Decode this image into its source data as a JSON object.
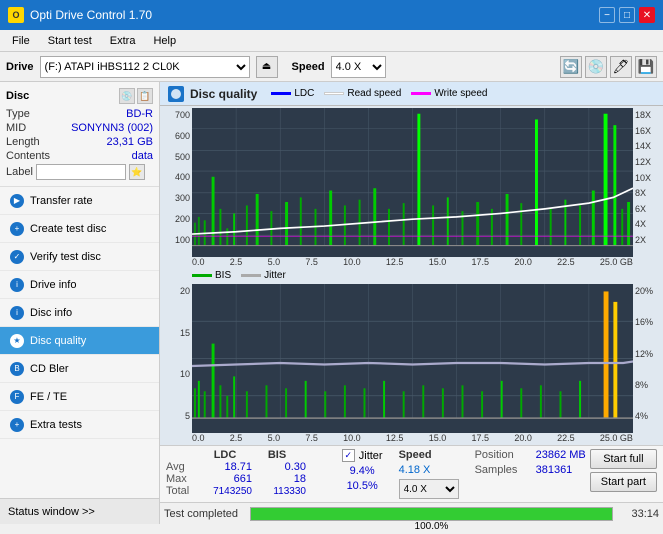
{
  "titlebar": {
    "title": "Opti Drive Control 1.70",
    "icon": "O",
    "minimize": "−",
    "maximize": "□",
    "close": "✕"
  },
  "menubar": {
    "items": [
      "File",
      "Start test",
      "Extra",
      "Help"
    ]
  },
  "drivebar": {
    "label": "Drive",
    "drive_value": "(F:)  ATAPI iHBS112  2 CL0K",
    "speed_label": "Speed",
    "speed_value": "4.0 X"
  },
  "disc": {
    "title": "Disc",
    "type_label": "Type",
    "type_val": "BD-R",
    "mid_label": "MID",
    "mid_val": "SONYNN3 (002)",
    "length_label": "Length",
    "length_val": "23,31 GB",
    "contents_label": "Contents",
    "contents_val": "data",
    "label_label": "Label"
  },
  "nav": {
    "items": [
      {
        "id": "transfer-rate",
        "label": "Transfer rate",
        "active": false
      },
      {
        "id": "create-test-disc",
        "label": "Create test disc",
        "active": false
      },
      {
        "id": "verify-test-disc",
        "label": "Verify test disc",
        "active": false
      },
      {
        "id": "drive-info",
        "label": "Drive info",
        "active": false
      },
      {
        "id": "disc-info",
        "label": "Disc info",
        "active": false
      },
      {
        "id": "disc-quality",
        "label": "Disc quality",
        "active": true
      },
      {
        "id": "cd-bler",
        "label": "CD Bler",
        "active": false
      },
      {
        "id": "fe-te",
        "label": "FE / TE",
        "active": false
      },
      {
        "id": "extra-tests",
        "label": "Extra tests",
        "active": false
      }
    ]
  },
  "status_window": "Status window >>",
  "content": {
    "title": "Disc quality",
    "legend": [
      {
        "label": "LDC",
        "color": "#0000ff"
      },
      {
        "label": "Read speed",
        "color": "#ffffff"
      },
      {
        "label": "Write speed",
        "color": "#ff00ff"
      }
    ],
    "legend2": [
      {
        "label": "BIS",
        "color": "#00aa00"
      },
      {
        "label": "Jitter",
        "color": "#aaaaaa"
      }
    ]
  },
  "chart1": {
    "y_labels": [
      "700",
      "600",
      "500",
      "400",
      "300",
      "200",
      "100"
    ],
    "y_right_labels": [
      "18X",
      "16X",
      "14X",
      "12X",
      "10X",
      "8X",
      "6X",
      "4X",
      "2X"
    ],
    "x_labels": [
      "0.0",
      "2.5",
      "5.0",
      "7.5",
      "10.0",
      "12.5",
      "15.0",
      "17.5",
      "20.0",
      "22.5",
      "25.0 GB"
    ]
  },
  "chart2": {
    "y_labels": [
      "20",
      "15",
      "10",
      "5"
    ],
    "y_right_labels": [
      "20%",
      "16%",
      "12%",
      "8%",
      "4%"
    ],
    "x_labels": [
      "0.0",
      "2.5",
      "5.0",
      "7.5",
      "10.0",
      "12.5",
      "15.0",
      "17.5",
      "20.0",
      "22.5",
      "25.0 GB"
    ]
  },
  "stats": {
    "headers": [
      "",
      "LDC",
      "BIS",
      "",
      "Jitter",
      "Speed"
    ],
    "avg_label": "Avg",
    "avg_ldc": "18.71",
    "avg_bis": "0.30",
    "avg_jitter": "9.4%",
    "max_label": "Max",
    "max_ldc": "661",
    "max_bis": "18",
    "max_jitter": "10.5%",
    "total_label": "Total",
    "total_ldc": "7143250",
    "total_bis": "113330",
    "jitter_label": "Jitter",
    "speed_label": "Speed",
    "speed_val": "4.18 X",
    "speed_select": "4.0 X",
    "position_label": "Position",
    "position_val": "23862 MB",
    "samples_label": "Samples",
    "samples_val": "381361",
    "start_full": "Start full",
    "start_part": "Start part"
  },
  "progress": {
    "status": "Test completed",
    "percent": "100.0%",
    "percent_num": 100,
    "time": "33:14"
  },
  "colors": {
    "accent_blue": "#1a73c8",
    "nav_active": "#3a9bdc",
    "progress_green": "#33cc33",
    "chart_bg": "#2d3a4a"
  }
}
